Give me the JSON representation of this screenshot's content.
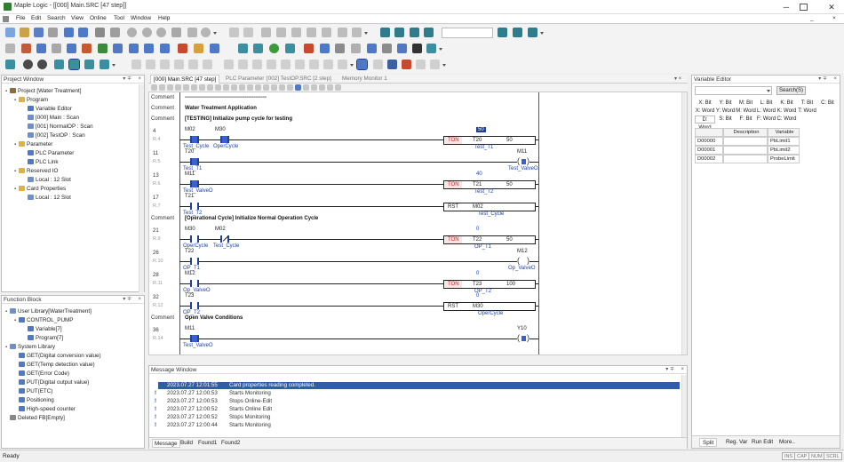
{
  "window": {
    "title": "Maple Logic - [[000] Main.SRC [47 step]]"
  },
  "menu": [
    "File",
    "Edit",
    "Search",
    "View",
    "Online",
    "Tool",
    "Window",
    "Help"
  ],
  "project": {
    "title": "Project Window",
    "items": [
      {
        "label": "Project [Water Treatment]",
        "level": 0,
        "icon": "project-icon"
      },
      {
        "label": "Program",
        "level": 1,
        "icon": "folder-icon"
      },
      {
        "label": "Variable Editor",
        "level": 2,
        "icon": "variable-icon"
      },
      {
        "label": "[000] Main : Scan",
        "level": 2,
        "icon": "scan-icon"
      },
      {
        "label": "[001] NormalOP : Scan",
        "level": 2,
        "icon": "scan-icon"
      },
      {
        "label": "[002] TestOP : Scan",
        "level": 2,
        "icon": "scan-icon"
      },
      {
        "label": "Parameter",
        "level": 1,
        "icon": "folder-icon"
      },
      {
        "label": "PLC Parameter",
        "level": 2,
        "icon": "parameter-icon"
      },
      {
        "label": "PLC Link",
        "level": 2,
        "icon": "link-icon"
      },
      {
        "label": "Reserved IO",
        "level": 1,
        "icon": "folder-icon"
      },
      {
        "label": "Local : 12 Slot",
        "level": 2,
        "icon": "slot-icon"
      },
      {
        "label": "Card Properties",
        "level": 1,
        "icon": "folder-icon"
      },
      {
        "label": "Local : 12 Slot",
        "level": 2,
        "icon": "slot-icon"
      }
    ]
  },
  "function_block": {
    "title": "Function Block",
    "items": [
      {
        "label": "User Library[WaterTreatment]",
        "level": 0,
        "icon": "library-icon"
      },
      {
        "label": "CONTROL_PUMP",
        "level": 1,
        "icon": "fb-icon"
      },
      {
        "label": "Variable[7]",
        "level": 2,
        "icon": "variable-icon"
      },
      {
        "label": "Program[7]",
        "level": 2,
        "icon": "program-icon"
      },
      {
        "label": "System Library",
        "level": 0,
        "icon": "library-icon"
      },
      {
        "label": "GET(Digital conversion value)",
        "level": 1,
        "icon": "fb-icon"
      },
      {
        "label": "GET(Temp detection value)",
        "level": 1,
        "icon": "fb-icon"
      },
      {
        "label": "GET(Error Code)",
        "level": 1,
        "icon": "fb-icon"
      },
      {
        "label": "PUT(Digital output value)",
        "level": 1,
        "icon": "fb-icon"
      },
      {
        "label": "PUT(ETC)",
        "level": 1,
        "icon": "fb-icon"
      },
      {
        "label": "Positioning",
        "level": 1,
        "icon": "fb-icon"
      },
      {
        "label": "High-speed counter",
        "level": 1,
        "icon": "fb-icon"
      },
      {
        "label": "Deleted FB[Empty]",
        "level": 0,
        "icon": "delete-icon"
      }
    ]
  },
  "editor_tabs": [
    "[000] Main.SRC [47 step]",
    "PLC Parameter",
    "[002] TestOP.SRC [2 step]",
    "Memory Monitor 1"
  ],
  "ladder": {
    "comment_label": "Comment",
    "rows": [
      {
        "kind": "comment",
        "text": "----------------------------------------------"
      },
      {
        "kind": "comment",
        "text": "Water Treatment Application"
      },
      {
        "kind": "comment",
        "text": "[TESTING] Initialize pump cycle for testing"
      },
      {
        "kind": "rung",
        "step": "4",
        "rnum": "R.4",
        "contacts": [
          {
            "dev": "M02",
            "cmt": "Test_Cycle",
            "on": true
          },
          {
            "dev": "M30",
            "cmt": "OperCycle",
            "on": true
          }
        ],
        "func": {
          "op": "TON",
          "a": "T20",
          "b": "50",
          "top": "50",
          "top_hl": true,
          "cmt": "Test_T1"
        }
      },
      {
        "kind": "rung",
        "step": "11",
        "rnum": "R.5",
        "contacts": [
          {
            "dev": "T20",
            "cmt": "Test_T1",
            "on": true
          }
        ],
        "coil": {
          "dev": "M11",
          "cmt": "Test_ValveO",
          "on": true
        }
      },
      {
        "kind": "rung",
        "step": "13",
        "rnum": "R.6",
        "contacts": [
          {
            "dev": "M11",
            "cmt": "Test_ValveO",
            "on": true
          }
        ],
        "func": {
          "op": "TON",
          "a": "T21",
          "b": "50",
          "top": "40",
          "top_hl": false,
          "cmt": "Test_T2"
        }
      },
      {
        "kind": "rung",
        "step": "17",
        "rnum": "R.7",
        "contacts": [
          {
            "dev": "T21",
            "cmt": "Test_T2",
            "on": false
          }
        ],
        "func": {
          "op": "RST",
          "a": "M02",
          "b": "",
          "top": "",
          "top_hl": false,
          "cmt": "Test_Cycle"
        }
      },
      {
        "kind": "comment",
        "text": "[Operational Cycle] Initialize Normal Operation Cycle"
      },
      {
        "kind": "rung",
        "step": "21",
        "rnum": "R.9",
        "contacts": [
          {
            "dev": "M30",
            "cmt": "OperCycle",
            "on": false
          },
          {
            "dev": "M02",
            "cmt": "Test_Cycle",
            "on": false,
            "nc": true
          }
        ],
        "func": {
          "op": "TON",
          "a": "T22",
          "b": "50",
          "top": "0",
          "top_hl": false,
          "cmt": "OP_T1"
        }
      },
      {
        "kind": "rung",
        "step": "26",
        "rnum": "R.10",
        "contacts": [
          {
            "dev": "T22",
            "cmt": "OP_T1",
            "on": false
          }
        ],
        "coil": {
          "dev": "M12",
          "cmt": "Op_ValveO",
          "on": false
        }
      },
      {
        "kind": "rung",
        "step": "28",
        "rnum": "R.11",
        "contacts": [
          {
            "dev": "M12",
            "cmt": "Op_ValveO",
            "on": false
          }
        ],
        "func": {
          "op": "TON",
          "a": "T23",
          "b": "100",
          "top": "0",
          "top_hl": false,
          "cmt": "OP_T2"
        }
      },
      {
        "kind": "rung",
        "step": "32",
        "rnum": "R.12",
        "contacts": [
          {
            "dev": "T23",
            "cmt": "OP_T2",
            "on": false
          }
        ],
        "func": {
          "op": "RST",
          "a": "M30",
          "b": "",
          "top": "0",
          "top_hl": false,
          "cmt": "OperCycle"
        }
      },
      {
        "kind": "comment",
        "text": "Open Valve Conditions"
      },
      {
        "kind": "rung",
        "step": "36",
        "rnum": "R.14",
        "contacts": [
          {
            "dev": "M11",
            "cmt": "Test_ValveO",
            "on": true
          }
        ],
        "coil": {
          "dev": "Y10",
          "cmt": "",
          "on": true
        }
      }
    ]
  },
  "message_window": {
    "title": "Message Window",
    "rows": [
      {
        "time": "2023.07.27 12:01:55",
        "text": "Card properties reading completed.",
        "selected": true
      },
      {
        "time": "2023.07.27 12:00:53",
        "text": "Starts Monitoring",
        "selected": false
      },
      {
        "time": "2023.07.27 12:00:53",
        "text": "Stops Online-Edit",
        "selected": false
      },
      {
        "time": "2023.07.27 12:00:52",
        "text": "Starts Online Edit",
        "selected": false
      },
      {
        "time": "2023.07.27 12:00:52",
        "text": "Stops Monitoring",
        "selected": false
      },
      {
        "time": "2023.07.27 12:00:44",
        "text": "Starts Monitoring",
        "selected": false
      }
    ],
    "tabs": [
      "Message",
      "Build",
      "Found1",
      "Found2"
    ]
  },
  "variable_editor": {
    "title": "Variable Editor",
    "search_label": "Search(S)",
    "type_rows": [
      [
        "X: Bit",
        "Y: Bit",
        "M: Bit",
        "L: Bit",
        "K: Bit",
        "T: Bit",
        "C: Bit"
      ],
      [
        "X: Word",
        "Y: Word",
        "M: Word",
        "L: Word",
        "K: Word",
        "T: Word"
      ],
      [
        "D: Word",
        "S: Bit",
        "F: Bit",
        "F: Word",
        "C: Word"
      ]
    ],
    "columns": [
      "",
      "Description",
      "Variable"
    ],
    "rows": [
      [
        "D00000",
        "",
        "PbLimit1"
      ],
      [
        "D00001",
        "",
        "PbLimit2"
      ],
      [
        "D00002",
        "",
        "ProbeLimit"
      ]
    ],
    "bottom_tabs": [
      "Split",
      "Reg. Var",
      "Run Edit",
      "More.."
    ]
  },
  "status": {
    "text": "Ready",
    "indicators": [
      "INS",
      "CAP",
      "NUM",
      "SCRL"
    ]
  }
}
